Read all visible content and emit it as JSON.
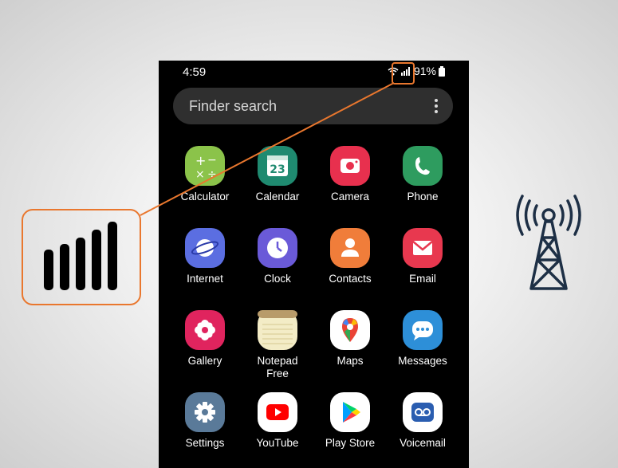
{
  "status_bar": {
    "time": "4:59",
    "battery": "91%"
  },
  "search": {
    "placeholder": "Finder search"
  },
  "apps": [
    {
      "label": "Calculator",
      "icon": "calculator-icon",
      "color": "#8bc34a"
    },
    {
      "label": "Calendar",
      "icon": "calendar-icon",
      "color": "#1f8a70",
      "badge": "23"
    },
    {
      "label": "Camera",
      "icon": "camera-icon",
      "color": "#e8304e"
    },
    {
      "label": "Phone",
      "icon": "phone-icon",
      "color": "#2e9c5f"
    },
    {
      "label": "Internet",
      "icon": "internet-icon",
      "color": "#5b6ee1"
    },
    {
      "label": "Clock",
      "icon": "clock-icon",
      "color": "#6a5ad8"
    },
    {
      "label": "Contacts",
      "icon": "contacts-icon",
      "color": "#f07d3a"
    },
    {
      "label": "Email",
      "icon": "email-icon",
      "color": "#e8384f"
    },
    {
      "label": "Gallery",
      "icon": "gallery-icon",
      "color": "#e0245e"
    },
    {
      "label": "Notepad Free",
      "icon": "notepad-icon",
      "color": "#f3ecc6"
    },
    {
      "label": "Maps",
      "icon": "maps-icon",
      "color": "#ffffff"
    },
    {
      "label": "Messages",
      "icon": "messages-icon",
      "color": "#2d8fd8"
    },
    {
      "label": "Settings",
      "icon": "settings-icon",
      "color": "#5a7a99"
    },
    {
      "label": "YouTube",
      "icon": "youtube-icon",
      "color": "#ffffff"
    },
    {
      "label": "Play Store",
      "icon": "play-store-icon",
      "color": "#ffffff"
    },
    {
      "label": "Voicemail",
      "icon": "voicemail-icon",
      "color": "#ffffff"
    }
  ],
  "accent_color": "#e9772e",
  "tower_color": "#1d2f45"
}
